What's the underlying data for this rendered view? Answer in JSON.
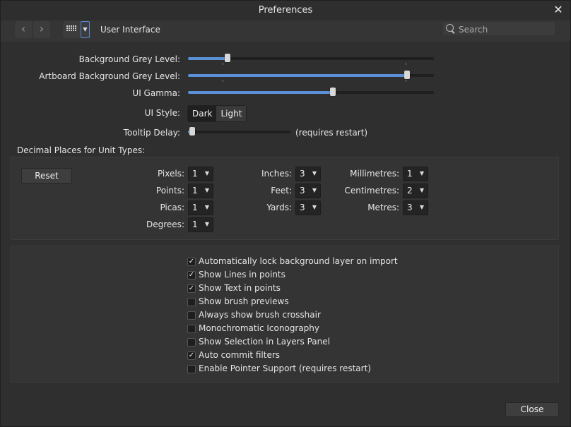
{
  "window": {
    "title": "Preferences"
  },
  "toolbar": {
    "section": "User Interface",
    "search_placeholder": "Search"
  },
  "sliders": [
    {
      "label": "Background Grey Level:",
      "value": 0.16
    },
    {
      "label": "Artboard Background Grey Level:",
      "value": 0.89
    },
    {
      "label": "UI Gamma:",
      "value": 0.59
    }
  ],
  "ui_style": {
    "label": "UI Style:",
    "options": [
      "Dark",
      "Light"
    ],
    "selected": "Dark"
  },
  "tooltip": {
    "label": "Tooltip Delay:",
    "note": "(requires restart)",
    "value": 0.04
  },
  "decimal": {
    "heading": "Decimal Places for Unit Types:",
    "reset": "Reset",
    "units": [
      {
        "label": "Pixels:",
        "value": "1"
      },
      {
        "label": "Points:",
        "value": "1"
      },
      {
        "label": "Picas:",
        "value": "1"
      },
      {
        "label": "Degrees:",
        "value": "1"
      },
      {
        "label": "Inches:",
        "value": "3"
      },
      {
        "label": "Feet:",
        "value": "3"
      },
      {
        "label": "Yards:",
        "value": "3"
      },
      {
        "label": "Millimetres:",
        "value": "1"
      },
      {
        "label": "Centimetres:",
        "value": "2"
      },
      {
        "label": "Metres:",
        "value": "3"
      }
    ]
  },
  "options": [
    {
      "label": "Automatically lock background layer on import",
      "checked": true
    },
    {
      "label": "Show Lines in points",
      "checked": true
    },
    {
      "label": "Show Text in points",
      "checked": true
    },
    {
      "label": "Show brush previews",
      "checked": false
    },
    {
      "label": "Always show brush crosshair",
      "checked": false
    },
    {
      "label": "Monochromatic Iconography",
      "checked": false
    },
    {
      "label": "Show Selection in Layers Panel",
      "checked": false
    },
    {
      "label": "Auto commit filters",
      "checked": true
    },
    {
      "label": "Enable Pointer Support (requires restart)",
      "checked": false
    }
  ],
  "footer": {
    "close": "Close"
  },
  "icons": {
    "back": "chevron-left-icon",
    "forward": "chevron-right-icon",
    "grid": "grid-icon",
    "search": "search-icon",
    "close": "close-icon",
    "check": "checkmark-icon"
  },
  "colors": {
    "accent": "#5b8fd6",
    "background": "#2f2f2f"
  }
}
